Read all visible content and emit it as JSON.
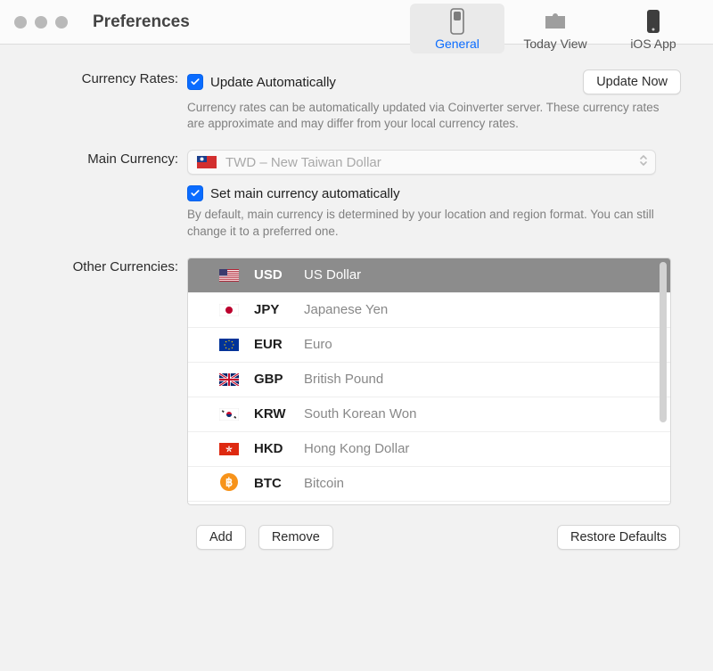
{
  "window": {
    "title": "Preferences"
  },
  "toolbar": {
    "items": [
      {
        "label": "General",
        "selected": true
      },
      {
        "label": "Today View",
        "selected": false
      },
      {
        "label": "iOS App",
        "selected": false
      }
    ]
  },
  "currencyRates": {
    "label": "Currency Rates:",
    "checkboxLabel": "Update Automatically",
    "buttonLabel": "Update Now",
    "description": "Currency rates can be automatically updated via Coinverter server. These currency rates are approximate and may differ from your local currency rates."
  },
  "mainCurrency": {
    "label": "Main Currency:",
    "selectedText": "TWD – New Taiwan Dollar",
    "setAutoLabel": "Set main currency automatically",
    "description": "By default, main currency is determined by your location and region format. You can still change it to a preferred one."
  },
  "otherCurrencies": {
    "label": "Other Currencies:",
    "items": [
      {
        "code": "USD",
        "name": "US Dollar",
        "selected": true
      },
      {
        "code": "JPY",
        "name": "Japanese Yen",
        "selected": false
      },
      {
        "code": "EUR",
        "name": "Euro",
        "selected": false
      },
      {
        "code": "GBP",
        "name": "British Pound",
        "selected": false
      },
      {
        "code": "KRW",
        "name": "South Korean Won",
        "selected": false
      },
      {
        "code": "HKD",
        "name": "Hong Kong Dollar",
        "selected": false
      },
      {
        "code": "BTC",
        "name": "Bitcoin",
        "selected": false
      }
    ]
  },
  "buttons": {
    "add": "Add",
    "remove": "Remove",
    "restore": "Restore Defaults"
  }
}
